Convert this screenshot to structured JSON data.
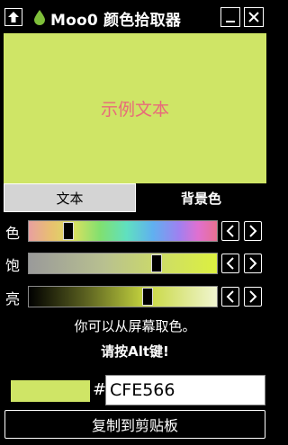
{
  "window": {
    "title": "Moo0 颜色拾取器",
    "icons": {
      "back": "up-arrow-icon",
      "app": "water-drop-icon",
      "minimize": "minimize-icon",
      "close": "close-icon"
    }
  },
  "preview": {
    "sample_text": "示例文本",
    "background_color": "#CFE566",
    "text_color": "#E86A7A"
  },
  "tabs": [
    {
      "label": "文本",
      "active": true
    },
    {
      "label": "背景色",
      "active": false
    }
  ],
  "sliders": [
    {
      "label": "色",
      "level": 0.21
    },
    {
      "label": "饱",
      "level": 0.68
    },
    {
      "label": "亮",
      "level": 0.63
    }
  ],
  "hint": {
    "line1": "你可以从屏幕取色。",
    "line2": "请按Alt键!"
  },
  "color": {
    "hash_symbol": "#",
    "hex_value": "CFE566"
  },
  "copy_button": {
    "label": "复制到剪贴板"
  }
}
